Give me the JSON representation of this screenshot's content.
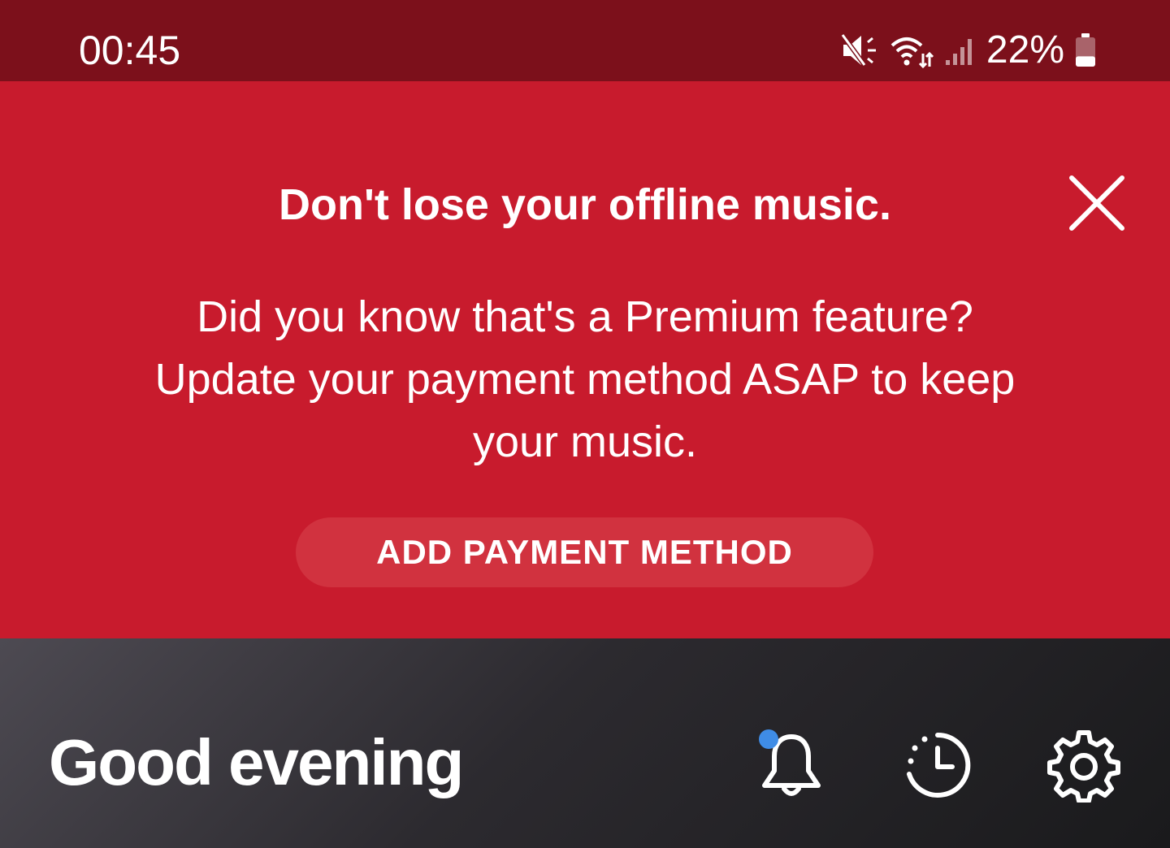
{
  "status_bar": {
    "time": "00:45",
    "battery_percent": "22%",
    "battery_level": 0.22,
    "icons": [
      "mute-icon",
      "wifi-icon",
      "signal-icon",
      "battery-icon"
    ]
  },
  "banner": {
    "title": "Don't lose your offline music.",
    "body_lines": [
      "Did you know that's a Premium feature?",
      "Update your payment method ASAP to keep",
      "your music."
    ],
    "cta_label": "ADD PAYMENT METHOD",
    "close_icon": "close-icon",
    "background_color": "#c81b2d",
    "button_color": "#d1323f"
  },
  "home": {
    "greeting": "Good evening",
    "icons": [
      "bell-icon",
      "recent-history-icon",
      "gear-icon"
    ],
    "notification_dot_color": "#3f8ce6"
  },
  "colors": {
    "status_bar": "#7c101b",
    "text": "#ffffff"
  }
}
